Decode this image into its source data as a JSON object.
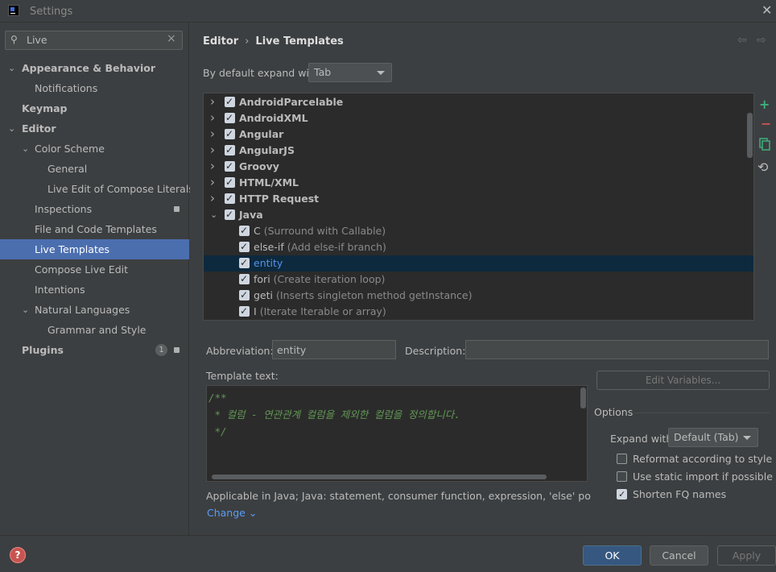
{
  "window": {
    "title": "Settings",
    "close": "✕"
  },
  "search": {
    "value": "Live",
    "icon": "search-icon"
  },
  "sidebar": {
    "items": [
      {
        "label": "Appearance & Behavior",
        "level": 0,
        "bold": true,
        "expanded": true
      },
      {
        "label": "Notifications",
        "level": 1
      },
      {
        "label": "Keymap",
        "level": 0,
        "bold": true
      },
      {
        "label": "Editor",
        "level": 0,
        "bold": true,
        "expanded": true
      },
      {
        "label": "Color Scheme",
        "level": 1,
        "expanded": true
      },
      {
        "label": "General",
        "level": 2
      },
      {
        "label": "Live Edit of Compose Literals",
        "level": 2
      },
      {
        "label": "Inspections",
        "level": 1,
        "badge": true
      },
      {
        "label": "File and Code Templates",
        "level": 1
      },
      {
        "label": "Live Templates",
        "level": 1,
        "selected": true
      },
      {
        "label": "Compose Live Edit",
        "level": 1
      },
      {
        "label": "Intentions",
        "level": 1
      },
      {
        "label": "Natural Languages",
        "level": 1,
        "expanded": true
      },
      {
        "label": "Grammar and Style",
        "level": 2
      },
      {
        "label": "Plugins",
        "level": 0,
        "bold": true,
        "count": "1",
        "badge": true
      }
    ]
  },
  "breadcrumb": {
    "parent": "Editor",
    "current": "Live Templates",
    "separator": "›"
  },
  "expand_default": {
    "label": "By default expand with",
    "value": "Tab"
  },
  "templates": [
    {
      "name": "AndroidParcelable",
      "group": true,
      "checked": true
    },
    {
      "name": "AndroidXML",
      "group": true,
      "checked": true
    },
    {
      "name": "Angular",
      "group": true,
      "checked": true
    },
    {
      "name": "AngularJS",
      "group": true,
      "checked": true
    },
    {
      "name": "Groovy",
      "group": true,
      "checked": true
    },
    {
      "name": "HTML/XML",
      "group": true,
      "checked": true
    },
    {
      "name": "HTTP Request",
      "group": true,
      "checked": true
    },
    {
      "name": "Java",
      "group": true,
      "checked": true,
      "expanded": true
    },
    {
      "name": "C",
      "desc": "(Surround with Callable)",
      "checked": true
    },
    {
      "name": "else-if",
      "desc": "(Add else-if branch)",
      "checked": true
    },
    {
      "name": "entity",
      "desc": "",
      "checked": true,
      "selected": true
    },
    {
      "name": "fori",
      "desc": "(Create iteration loop)",
      "checked": true
    },
    {
      "name": "geti",
      "desc": "(Inserts singleton method getInstance)",
      "checked": true
    },
    {
      "name": "I",
      "desc": "(Iterate Iterable or array)",
      "checked": true
    }
  ],
  "toolbar": {
    "add": "+",
    "remove": "−",
    "restore": "⟲"
  },
  "detail": {
    "abbreviation_label": "Abbreviation:",
    "abbreviation_value": "entity",
    "description_label": "Description:",
    "description_value": "",
    "template_text_label": "Template text:",
    "template_text": "/**\n * 컬럼 - 연관관계 컬럼을 제외한 컬럼을 정의합니다.\n */",
    "edit_variables": "Edit Variables...",
    "applicable": "Applicable in Java; Java: statement, consumer function, expression, 'else' position, dec...",
    "change": "Change ⌄"
  },
  "options": {
    "title": "Options",
    "expand_with_label": "Expand with",
    "expand_with_value": "Default (Tab)",
    "checks": [
      {
        "label": "Reformat according to style",
        "checked": false
      },
      {
        "label": "Use static import if possible",
        "checked": false
      },
      {
        "label": "Shorten FQ names",
        "checked": true
      }
    ]
  },
  "buttons": {
    "help": "?",
    "ok": "OK",
    "cancel": "Cancel",
    "apply": "Apply"
  },
  "colors": {
    "accent": "#4b6eaf",
    "selected_row": "#0d293e",
    "comment_green": "#629755",
    "link": "#589df6"
  }
}
